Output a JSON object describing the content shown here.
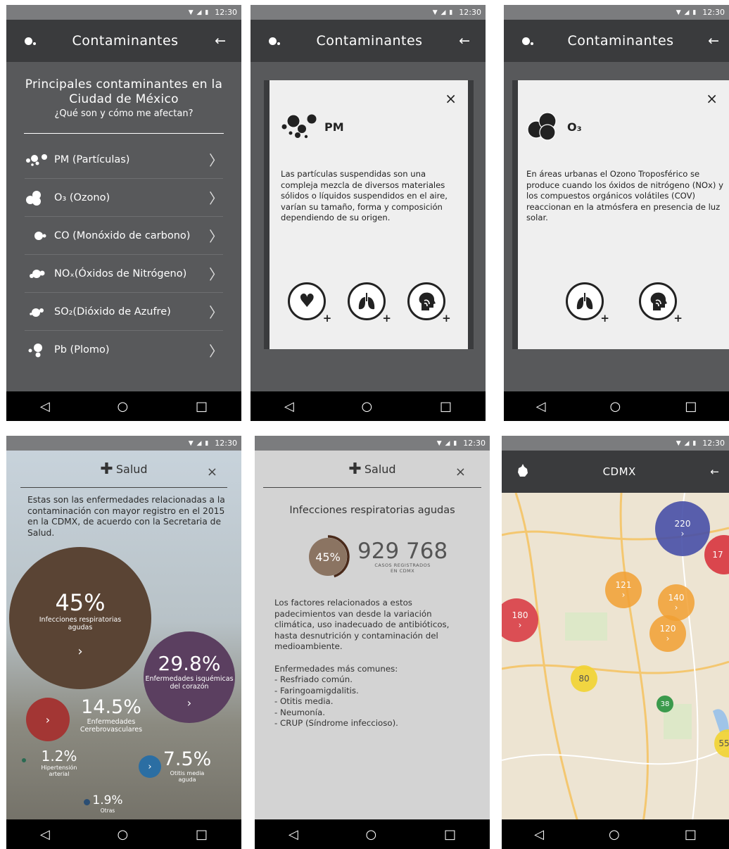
{
  "status": {
    "time": "12:30"
  },
  "screens": {
    "list": {
      "title": "Contaminantes",
      "back": "←",
      "heading_line1": "Principales contaminantes en la",
      "heading_line2": "Ciudad de México",
      "subheading": "¿Qué son y cómo me afectan?",
      "items": [
        {
          "label": "PM (Partículas)"
        },
        {
          "label": "O₃ (Ozono)"
        },
        {
          "label": "CO (Monóxido de carbono)"
        },
        {
          "label": "NOₓ(Óxidos de Nitrógeno)"
        },
        {
          "label": "SO₂(Dióxido de Azufre)"
        },
        {
          "label": "Pb (Plomo)"
        }
      ]
    },
    "pm": {
      "title": "Contaminantes",
      "close": "×",
      "name": "PM",
      "description": "Las partículas suspendidas son una compleja mezcla de diversos materiales sólidos o líquidos suspendidos en el aire, varían su tamaño, forma y composición dependiendo de su origen."
    },
    "o3": {
      "title": "Contaminantes",
      "close": "×",
      "name": "O₃",
      "description": "En áreas urbanas el Ozono Troposférico se produce cuando los óxidos de nitrógeno (NOx) y los compuestos orgánicos volátiles (COV) reaccionan en la atmósfera en presencia de luz solar."
    },
    "health": {
      "title": "Salud",
      "close": "×",
      "text": "Estas son las enfermedades relacionadas a la contaminación con mayor registro en el 2015 en la CDMX, de acuerdo con la Secretaria de Salud.",
      "items": [
        {
          "pct": "45%",
          "label": "Infecciones respiratorias agudas",
          "color": "#5a4434"
        },
        {
          "pct": "29.8%",
          "label": "Enfermedades isquémicas del corazón",
          "color": "#5b3f60"
        },
        {
          "pct": "14.5%",
          "label": "Enfermedades Cerebrovasculares",
          "color": "#a33634"
        },
        {
          "pct": "1.2%",
          "label": "Hipertensión arterial",
          "color": "#2a6a52"
        },
        {
          "pct": "7.5%",
          "label": "Otitis media aguda",
          "color": "#2b6ea3"
        },
        {
          "pct": "1.9%",
          "label": "Otras",
          "color": "#2b4e73"
        }
      ],
      "arrow": "›"
    },
    "detail": {
      "title": "Salud",
      "close": "×",
      "heading": "Infecciones respiratorias agudas",
      "pct": "45%",
      "pct_value": 0.45,
      "cases": "929 768",
      "cases_label_1": "CASOS REGISTRADOS",
      "cases_label_2": "EN CDMX",
      "para1": "Los factores relacionados a estos padecimientos van desde la variación climática, uso inadecuado de antibióticos, hasta desnutrición y contaminación del medioambiente.",
      "common_title": "Enfermedades más comunes:",
      "common": [
        "- Resfriado común.",
        "- Faringoamigdalitis.",
        "- Otitis media.",
        "- Neumonía.",
        "- CRUP (Síndrome infeccioso)."
      ]
    },
    "map": {
      "title": "CDMX",
      "back": "←",
      "clusters": [
        {
          "value": "220",
          "color": "#4850a8"
        },
        {
          "value": "17",
          "color": "#d8353f"
        },
        {
          "value": "121",
          "color": "#f2a033"
        },
        {
          "value": "140",
          "color": "#f2a033"
        },
        {
          "value": "180",
          "color": "#d8353f"
        },
        {
          "value": "120",
          "color": "#f2a033"
        },
        {
          "value": "80",
          "color": "#f2d432"
        },
        {
          "value": "38",
          "color": "#3b9a4c"
        },
        {
          "value": "55",
          "color": "#f2d432"
        }
      ]
    }
  },
  "nav": {
    "back": "◁",
    "home": "○",
    "recent": "□"
  }
}
